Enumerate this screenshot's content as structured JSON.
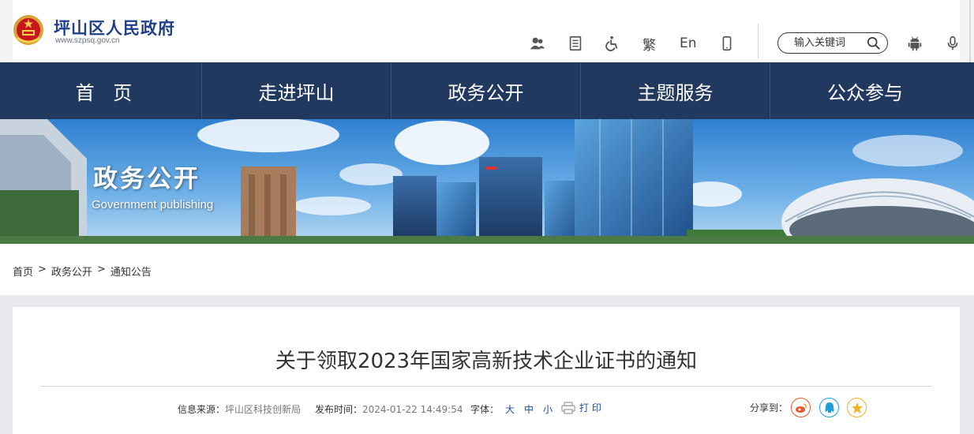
{
  "site": {
    "name": "坪山区人民政府",
    "url": "www.szpsq.gov.cn"
  },
  "toolbar": {
    "icons": [
      "care-icon",
      "doc-icon",
      "accessibility-icon",
      "traditional-chinese",
      "english",
      "mobile-icon",
      "android-icon",
      "voice-icon"
    ],
    "traditional_label": "繁",
    "english_label": "En"
  },
  "search": {
    "placeholder": "输入关键词"
  },
  "nav": {
    "items": [
      "首 页",
      "走进坪山",
      "政务公开",
      "主题服务",
      "公众参与"
    ]
  },
  "banner": {
    "title": "政务公开",
    "subtitle": "Government publishing"
  },
  "breadcrumb": {
    "items": [
      "首页",
      "政务公开",
      "通知公告"
    ],
    "separator": ">"
  },
  "article": {
    "title": "关于领取2023年国家高新技术企业证书的通知",
    "source_label": "信息来源：",
    "source_value": "坪山区科技创新局",
    "time_label": "发布时间：",
    "time_value": "2024-01-22 14:49:54",
    "font_label": "字体：",
    "font_sizes": [
      "大",
      "中",
      "小"
    ],
    "print_label": "打 印",
    "share_label": "分享到："
  },
  "colors": {
    "nav_bg": "#22395f",
    "brand_blue": "#1f3f8a",
    "weibo": "#e8572d",
    "qq": "#1e9fd9",
    "qzone": "#f0b429"
  }
}
